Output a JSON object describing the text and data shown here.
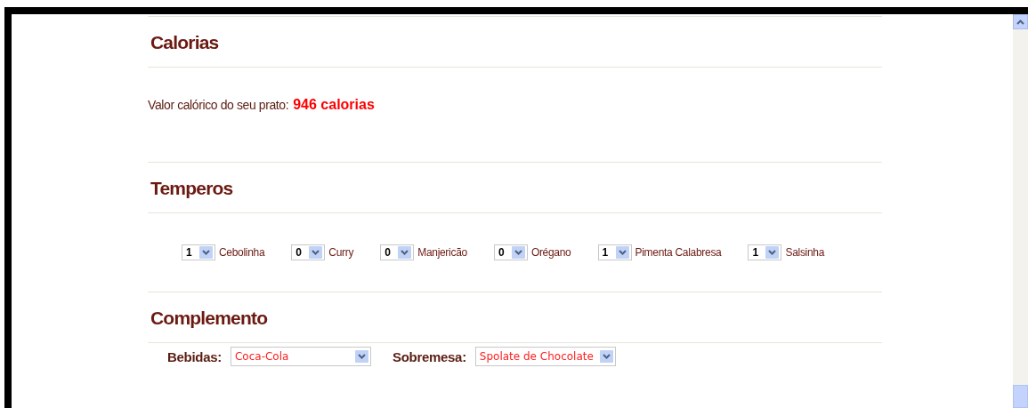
{
  "sections": [
    {
      "kind": "calories",
      "title": "Calorias",
      "label": "Valor calórico do seu prato:",
      "value": "946 calorias"
    },
    {
      "kind": "spices",
      "title": "Temperos",
      "items": [
        {
          "quantity": "1",
          "name": "Cebolinha"
        },
        {
          "quantity": "0",
          "name": "Curry"
        },
        {
          "quantity": "0",
          "name": "Manjericão"
        },
        {
          "quantity": "0",
          "name": "Orégano"
        },
        {
          "quantity": "1",
          "name": "Pimenta Calabresa"
        },
        {
          "quantity": "1",
          "name": "Salsinha"
        }
      ]
    },
    {
      "kind": "extras",
      "title": "Complemento",
      "fields": [
        {
          "label": "Bebidas:",
          "value": "Coca-Cola"
        },
        {
          "label": "Sobremesa:",
          "value": "Spolate de Chocolate"
        }
      ]
    }
  ]
}
